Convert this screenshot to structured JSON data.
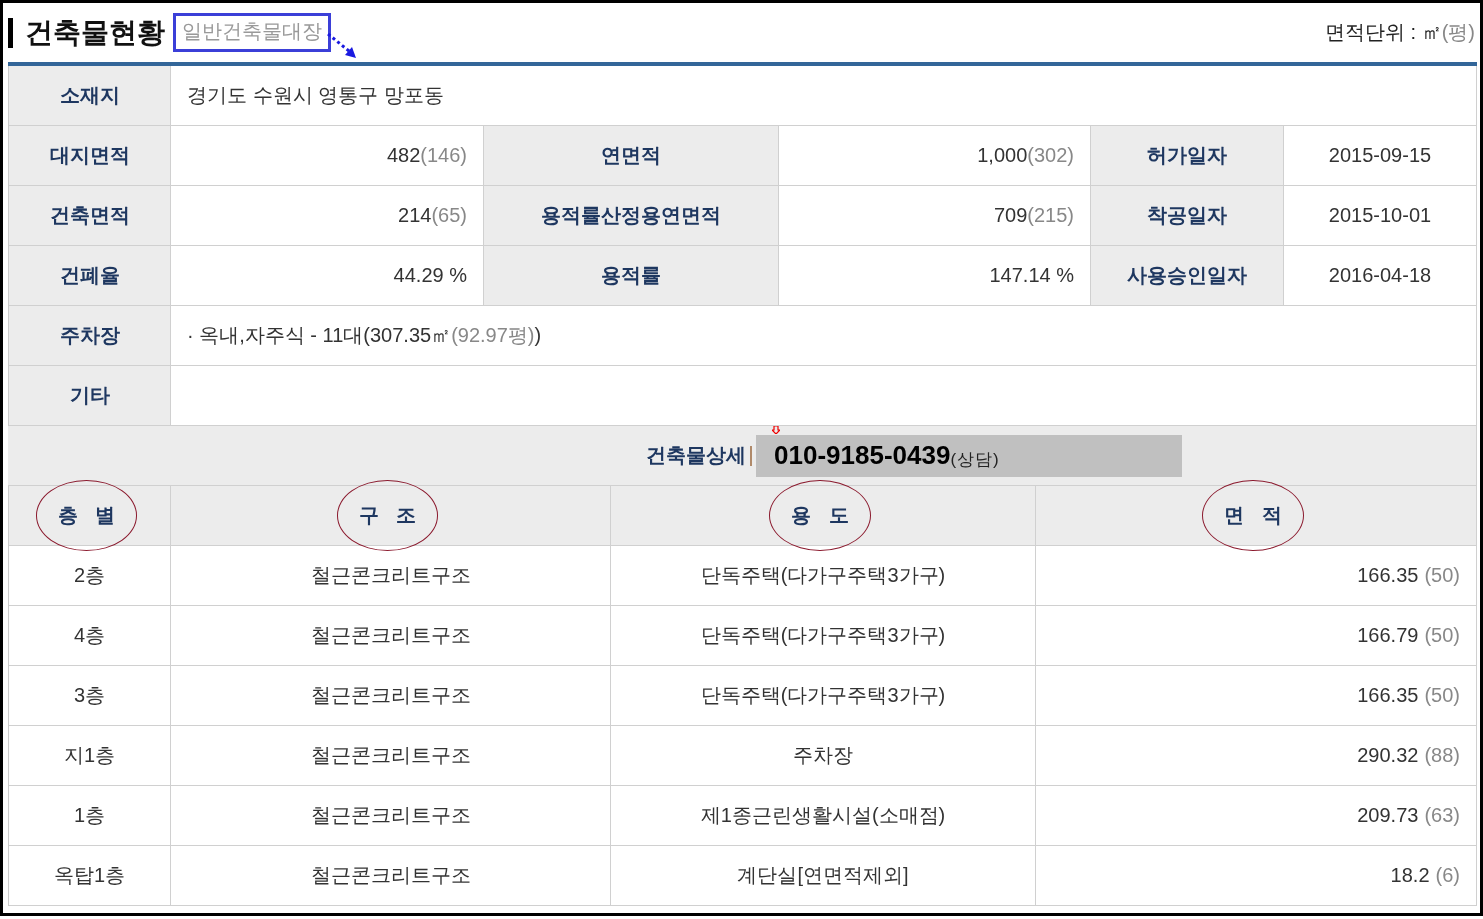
{
  "header": {
    "title": "건축물현황",
    "subtitle": "일반건축물대장",
    "subtitle_boxed": true,
    "unit_label": "면적단위 : ㎡",
    "unit_paren": "(평)"
  },
  "info": {
    "rows": [
      {
        "cells": [
          {
            "kind": "label",
            "text": "소재지"
          },
          {
            "kind": "wide",
            "text": "경기도 수원시 영통구 망포동"
          }
        ]
      },
      {
        "cells": [
          {
            "kind": "label",
            "text": "대지면적"
          },
          {
            "kind": "number",
            "text": "482",
            "paren": "(146)"
          },
          {
            "kind": "label",
            "text": "연면적"
          },
          {
            "kind": "number",
            "text": "1,000",
            "paren": "(302)"
          },
          {
            "kind": "label",
            "text": "허가일자"
          },
          {
            "kind": "date",
            "text": "2015-09-15"
          }
        ]
      },
      {
        "cells": [
          {
            "kind": "label",
            "text": "건축면적"
          },
          {
            "kind": "number",
            "text": "214",
            "paren": "(65)"
          },
          {
            "kind": "label",
            "text": "용적률산정용연면적"
          },
          {
            "kind": "number",
            "text": "709",
            "paren": "(215)"
          },
          {
            "kind": "label",
            "text": "착공일자"
          },
          {
            "kind": "date",
            "text": "2015-10-01"
          }
        ]
      },
      {
        "cells": [
          {
            "kind": "label",
            "text": "건폐율"
          },
          {
            "kind": "number",
            "text": "44.29 %"
          },
          {
            "kind": "label",
            "text": "용적률"
          },
          {
            "kind": "number",
            "text": "147.14 %"
          },
          {
            "kind": "label",
            "text": "사용승인일자"
          },
          {
            "kind": "date",
            "text": "2016-04-18"
          }
        ]
      },
      {
        "cells": [
          {
            "kind": "label",
            "text": "주차장"
          },
          {
            "kind": "wide",
            "text": "· 옥내,자주식 - 11대(307.35㎡ ",
            "paren": "(92.97평)",
            "tail": ")"
          }
        ]
      },
      {
        "cells": [
          {
            "kind": "label",
            "text": "기타"
          },
          {
            "kind": "wide",
            "text": ""
          }
        ]
      }
    ]
  },
  "detail": {
    "label": "건축물상세",
    "phone": "010-9185-0439",
    "phone_note": "(상담)"
  },
  "floors": {
    "columns": [
      {
        "label": "층 별",
        "circled": true
      },
      {
        "label": "구 조",
        "circled": true
      },
      {
        "label": "용 도",
        "circled": true
      },
      {
        "label": "면 적",
        "circled": true
      }
    ],
    "rows": [
      {
        "floor": "2층",
        "structure": "철근콘크리트구조",
        "use": "단독주택(다가구주택3가구)",
        "area": "166.35",
        "area_paren": "(50)"
      },
      {
        "floor": "4층",
        "structure": "철근콘크리트구조",
        "use": "단독주택(다가구주택3가구)",
        "area": "166.79",
        "area_paren": "(50)"
      },
      {
        "floor": "3층",
        "structure": "철근콘크리트구조",
        "use": "단독주택(다가구주택3가구)",
        "area": "166.35",
        "area_paren": "(50)"
      },
      {
        "floor": "지1층",
        "structure": "철근콘크리트구조",
        "use": "주차장",
        "area": "290.32",
        "area_paren": "(88)"
      },
      {
        "floor": "1층",
        "structure": "철근콘크리트구조",
        "use": "제1종근린생활시설(소매점)",
        "area": "209.73",
        "area_paren": "(63)"
      },
      {
        "floor": "옥탑1층",
        "structure": "철근콘크리트구조",
        "use": "계단실[연면적제외]",
        "area": "18.2",
        "area_paren": "(6)"
      }
    ]
  }
}
